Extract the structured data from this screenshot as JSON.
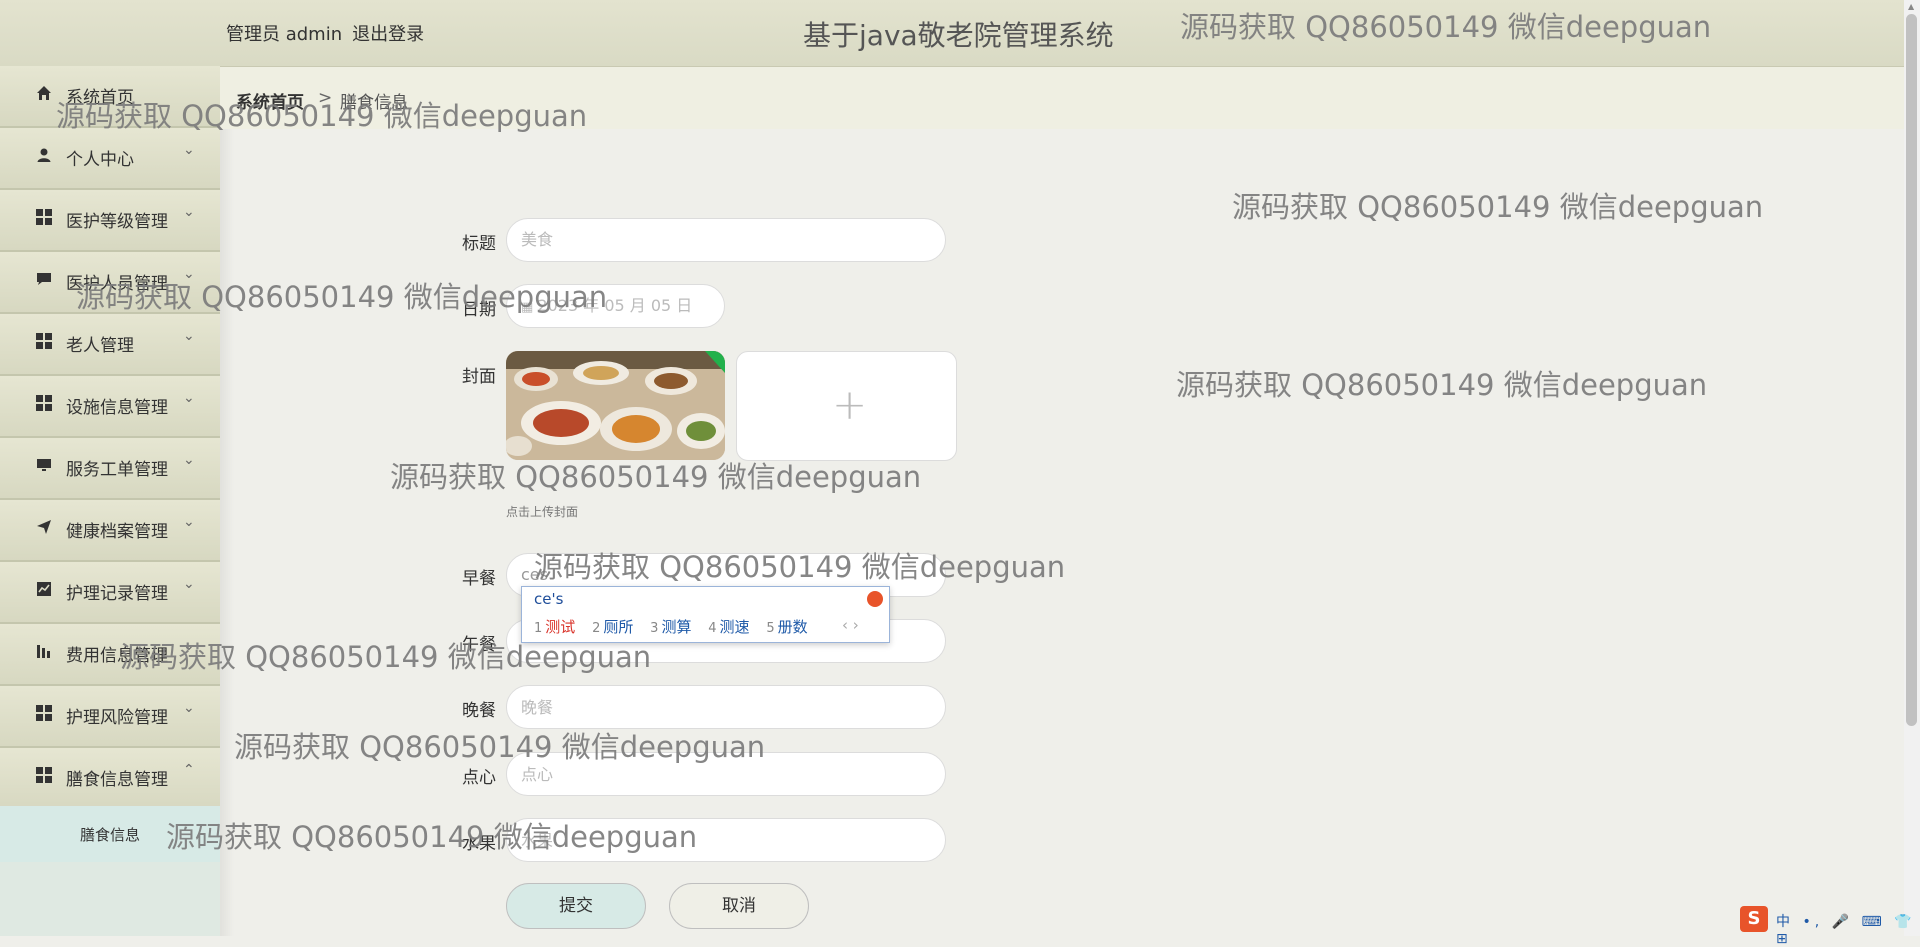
{
  "header": {
    "user_label": "管理员 admin",
    "logout_label": "退出登录",
    "system_title": "基于java敬老院管理系统"
  },
  "sidebar": {
    "items": [
      {
        "label": "系统首页",
        "icon": "home-icon"
      },
      {
        "label": "个人中心",
        "icon": "user-icon"
      },
      {
        "label": "医护等级管理",
        "icon": "grid-icon"
      },
      {
        "label": "医护人员管理",
        "icon": "chat-icon"
      },
      {
        "label": "老人管理",
        "icon": "grid-icon"
      },
      {
        "label": "设施信息管理",
        "icon": "grid-icon"
      },
      {
        "label": "服务工单管理",
        "icon": "monitor-icon"
      },
      {
        "label": "健康档案管理",
        "icon": "send-icon"
      },
      {
        "label": "护理记录管理",
        "icon": "chart-icon"
      },
      {
        "label": "费用信息管理",
        "icon": "bar-icon"
      },
      {
        "label": "护理风险管理",
        "icon": "grid-icon"
      },
      {
        "label": "膳食信息管理",
        "icon": "grid-icon"
      }
    ],
    "active_sub": "膳食信息"
  },
  "breadcrumb": {
    "home": "系统首页",
    "separator": ">",
    "current": "膳食信息"
  },
  "form": {
    "title_label": "标题",
    "title_value": "美食",
    "date_label": "日期",
    "date_value": "2023 年 05 月 05 日",
    "cover_label": "封面",
    "upload_plus": "+",
    "upload_tip": "点击上传封面",
    "breakfast_label": "早餐",
    "breakfast_value": "ces",
    "lunch_label": "午餐",
    "lunch_value": "",
    "dinner_label": "晚餐",
    "dinner_placeholder": "晚餐",
    "snack_label": "点心",
    "snack_placeholder": "点心",
    "fruit_label": "水果",
    "fruit_placeholder": "水果",
    "submit_label": "提交",
    "cancel_label": "取消"
  },
  "ime": {
    "input": "ce's",
    "candidates": [
      "测试",
      "厕所",
      "测算",
      "测速",
      "册数"
    ],
    "nav": "‹ ›"
  },
  "tray": {
    "logo": "S",
    "items": "中 •, 🎤 ⌨ 👕 ⊞"
  },
  "watermark": "源码获取 QQ86050149 微信deepguan"
}
